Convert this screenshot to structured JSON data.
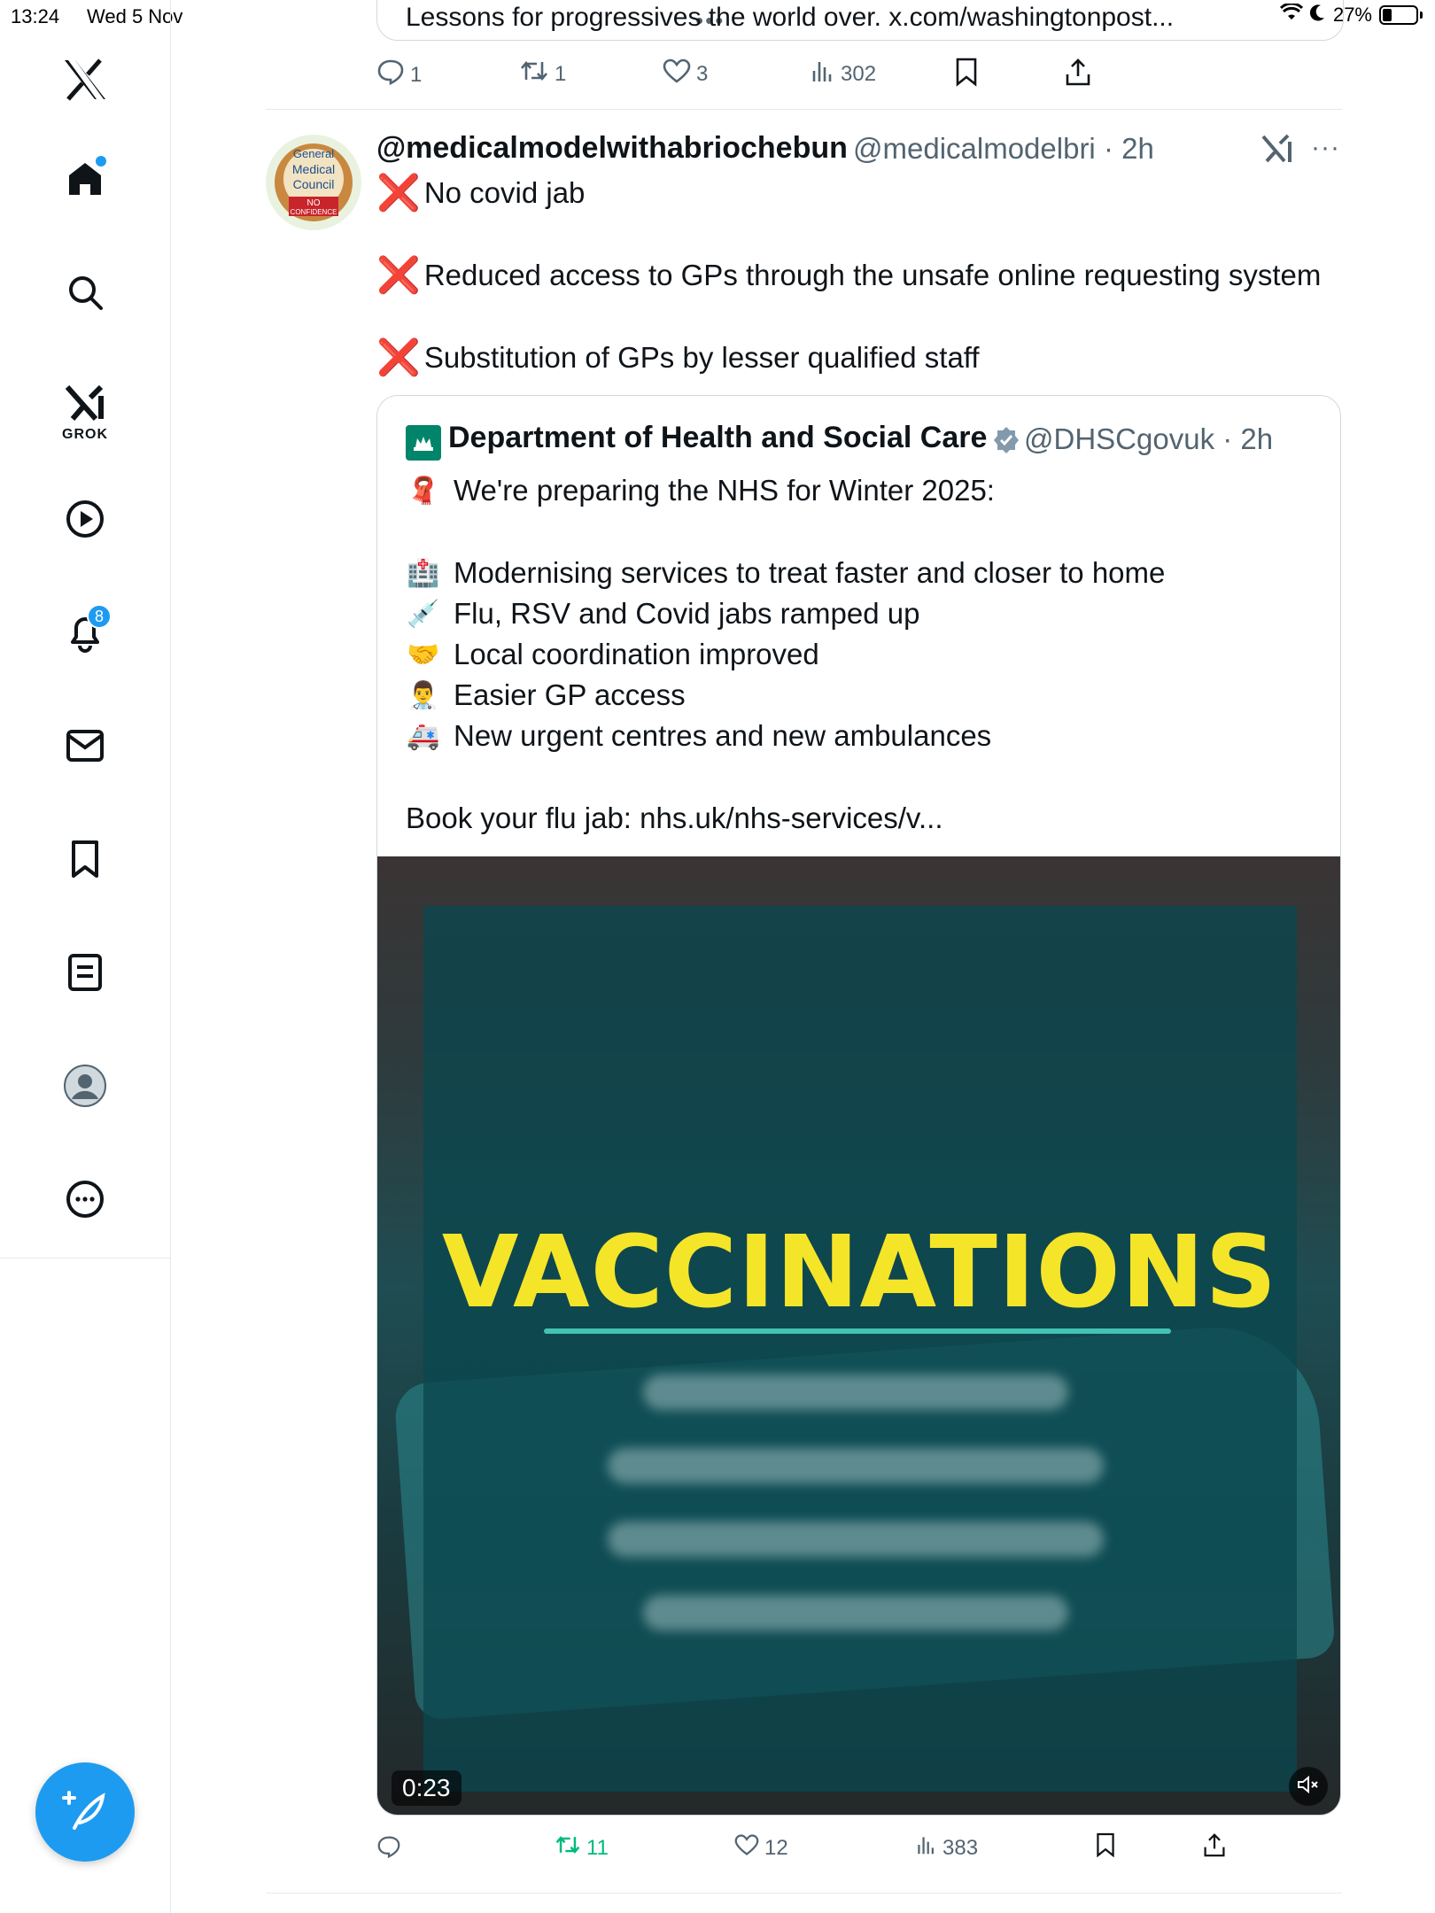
{
  "status_bar": {
    "time": "13:24",
    "date": "Wed 5 Nov",
    "battery": "27%"
  },
  "sidebar": {
    "notifications_badge": "8",
    "grok_label": "GROK"
  },
  "previous_post": {
    "card_text": "Lessons for progressives the world over. x.com/washingtonpost...",
    "replies": "1",
    "reposts": "1",
    "likes": "3",
    "views": "302"
  },
  "post": {
    "display_name": "@medicalmodelwithabriochebun",
    "handle": "@medicalmodelbri",
    "separator": "·",
    "time": "2h",
    "avatar_text": [
      "General",
      "Medical",
      "Council",
      "NO",
      "CONFIDENCE"
    ],
    "lines": [
      "No covid jab",
      "Reduced access to GPs through the unsafe online requesting system",
      "Substitution of GPs by lesser qualified staff"
    ],
    "line_marker": "❌",
    "reposts": "11",
    "likes": "12",
    "views": "383"
  },
  "quote": {
    "display_name": "Department of Health and Social Care",
    "handle": "@DHSCgovuk",
    "separator": "·",
    "time": "2h",
    "intro": {
      "emoji": "🧣",
      "text": "We're preparing the NHS for Winter 2025:"
    },
    "items": [
      {
        "emoji": "🏥",
        "text": "Modernising services to treat faster and closer to home"
      },
      {
        "emoji": "💉",
        "text": "Flu, RSV and Covid jabs ramped up"
      },
      {
        "emoji": "🤝",
        "text": "Local coordination improved"
      },
      {
        "emoji": "👨‍⚕️",
        "text": "Easier GP access"
      },
      {
        "emoji": "🚑",
        "text": "New urgent centres and new ambulances"
      }
    ],
    "footer": "Book your flu jab: nhs.uk/nhs-services/v...",
    "video": {
      "headline": "VACCINATIONS",
      "duration": "0:23"
    }
  },
  "colors": {
    "accent": "#1d9bf0",
    "repost_active": "#00ba7c",
    "headline": "#f5e529",
    "x_mark": "#dd2e44"
  }
}
